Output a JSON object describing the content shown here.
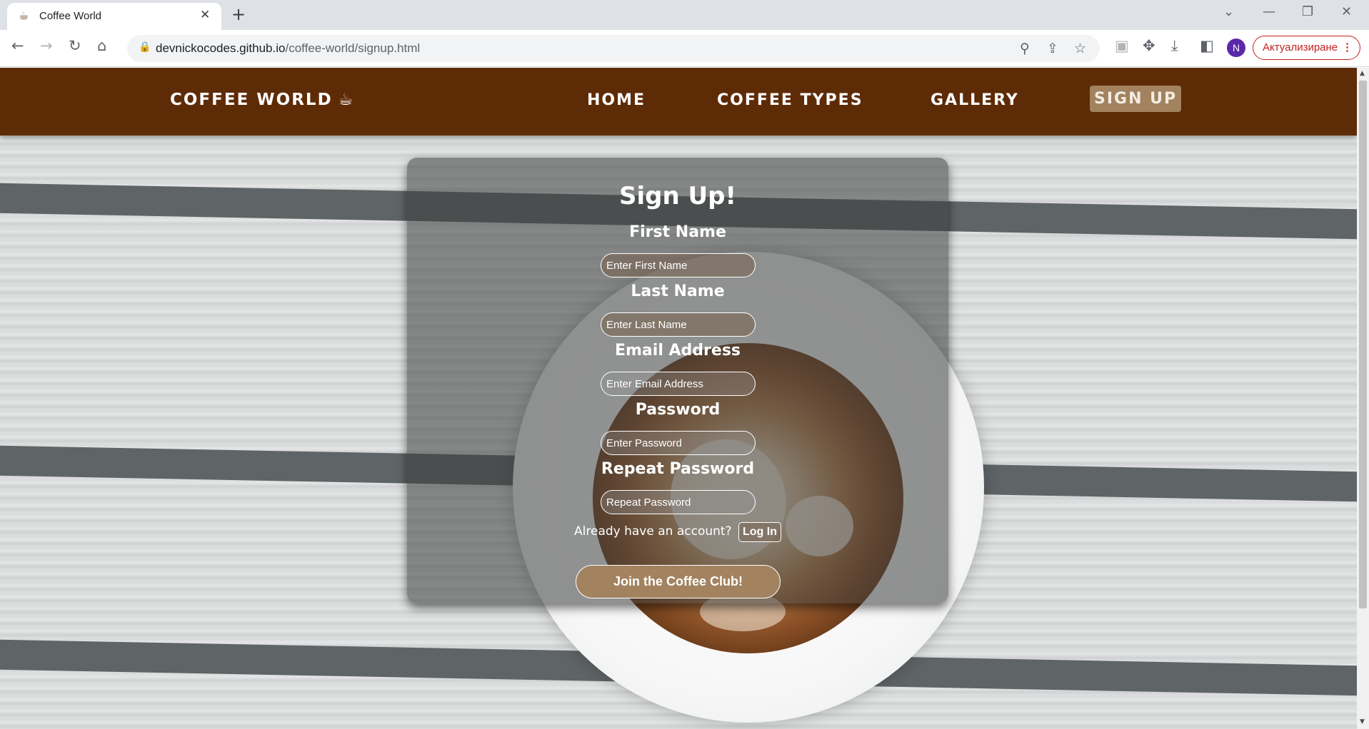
{
  "browser": {
    "tab_title": "Coffee World",
    "url_host": "devnickocodes.github.io",
    "url_path": "/coffee-world/signup.html",
    "profile_initial": "N",
    "update_label": "Актуализиране",
    "icons": [
      "back-icon",
      "forward-icon",
      "reload-icon",
      "home-icon",
      "lock-icon",
      "zoom-icon",
      "share-icon",
      "star-icon",
      "extension-icon",
      "puzzle-icon",
      "download-icon",
      "sidepanel-icon",
      "menu-icon"
    ]
  },
  "site": {
    "brand": "COFFEE WORLD",
    "nav": [
      {
        "label": "HOME"
      },
      {
        "label": "COFFEE TYPES"
      },
      {
        "label": "GALLERY"
      },
      {
        "label": "SIGN UP",
        "active": true
      }
    ],
    "accent_color": "#a2825f",
    "header_color": "#5e2b07"
  },
  "form": {
    "title": "Sign Up!",
    "fields": [
      {
        "label": "First Name",
        "placeholder": "Enter First Name"
      },
      {
        "label": "Last Name",
        "placeholder": "Enter Last Name"
      },
      {
        "label": "Email Address",
        "placeholder": "Enter Email Address"
      },
      {
        "label": "Password",
        "placeholder": "Enter Password"
      },
      {
        "label": "Repeat Password",
        "placeholder": "Repeat Password"
      }
    ],
    "login_prompt": "Already have an account?",
    "login_button": "Log In",
    "submit_button": "Join the Coffee Club!"
  }
}
